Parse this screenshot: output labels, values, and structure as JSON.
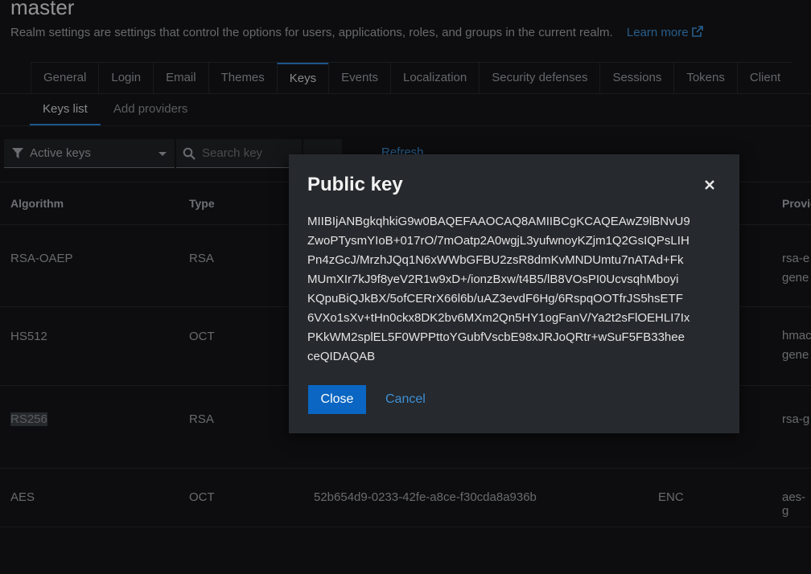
{
  "realm": {
    "title": "master",
    "description": "Realm settings are settings that control the options for users, applications, roles, and groups in the current realm.",
    "learn_more": "Learn more"
  },
  "tabs": [
    "General",
    "Login",
    "Email",
    "Themes",
    "Keys",
    "Events",
    "Localization",
    "Security defenses",
    "Sessions",
    "Tokens",
    "Client"
  ],
  "active_tab": "Keys",
  "subtabs": [
    "Keys list",
    "Add providers"
  ],
  "toolbar": {
    "filter_label": "Active keys",
    "search_placeholder": "Search key",
    "refresh_label": "Refresh"
  },
  "table": {
    "headers": [
      "Algorithm",
      "Type",
      "",
      "",
      "Provider"
    ],
    "rows": [
      {
        "algorithm": "RSA-OAEP",
        "type": "RSA",
        "provider_l1": "rsa-e",
        "provider_l2": "gene"
      },
      {
        "algorithm": "HS512",
        "type": "OCT",
        "provider_l1": "hmac",
        "provider_l2": "gene"
      },
      {
        "algorithm": "RS256",
        "type": "RSA",
        "provider_l1": "rsa-g",
        "provider_l2": ""
      },
      {
        "algorithm": "AES",
        "type": "OCT",
        "kid": "52b654d9-0233-42fe-a8ce-f30cda8a936b",
        "use": "ENC",
        "provider_l1": "aes-g",
        "provider_l2": ""
      }
    ]
  },
  "modal": {
    "title": "Public key",
    "key_lines": [
      "MIIBIjANBgkqhkiG9w0BAQEFAAOCAQ8AMIIBCgKCAQEAwZ9lBNvU9",
      "ZwoPTysmYIoB+017rO/7mOatp2A0wgjL3yufwnoyKZjm1Q2GsIQPsLIH",
      "Pn4zGcJ/MrzhJQq1N6xWWbGFBU2zsR8dmKvMNDUmtu7nATAd+Fk",
      "MUmXIr7kJ9f8yeV2R1w9xD+/ionzBxw/t4B5/lB8VOsPI0UcvsqhMboyi",
      "KQpuBiQJkBX/5ofCERrX66l6b/uAZ3evdF6Hg/6RspqOOTfrJS5hsETF",
      "6VXo1sXv+tHn0ckx8DK2bv6MXm2Qn5HY1ogFanV/Ya2t2sFlOEHLI7Ix",
      "PKkWM2splEL5F0WPPttoYGubfVscbE98xJRJoQRtr+wSuF5FB33hee",
      "ceQIDAQAB"
    ],
    "close_label": "Close",
    "cancel_label": "Cancel"
  },
  "colors": {
    "accent": "#0a66c2",
    "link": "#3d8fd6",
    "modal_bg": "#26292d",
    "page_bg": "#141517"
  }
}
